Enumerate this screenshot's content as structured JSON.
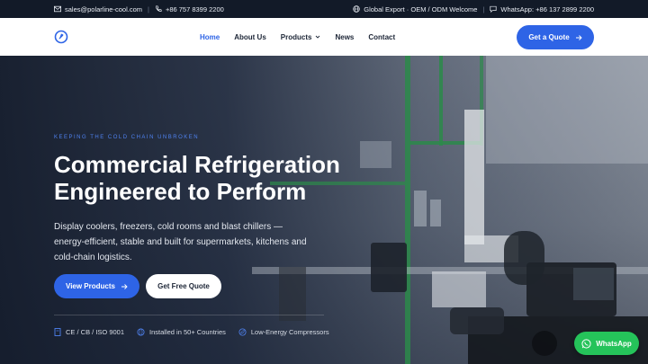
{
  "topbar": {
    "email": "sales@polarline-cool.com",
    "phone": "+86 757 8399 2200",
    "export_text": "Global Export · OEM / ODM Welcome",
    "whatsapp_text": "WhatsApp: +86 137 2899 2200"
  },
  "header": {
    "nav": [
      {
        "label": "Home"
      },
      {
        "label": "About Us"
      },
      {
        "label": "Products"
      },
      {
        "label": "News"
      },
      {
        "label": "Contact"
      }
    ],
    "quote_label": "Get a Quote"
  },
  "hero": {
    "eyebrow": "KEEPING THE COLD CHAIN UNBROKEN",
    "title_line1": "Commercial Refrigeration",
    "title_line2": "Engineered to Perform",
    "subtitle": "Display coolers, freezers, cold rooms and blast chillers — energy-efficient, stable and built for supermarkets, kitchens and cold-chain logistics.",
    "primary_label": "View Products",
    "secondary_label": "Get Free Quote",
    "features": [
      {
        "label": "CE / CB / ISO 9001",
        "icon": "certificate-icon"
      },
      {
        "label": "Installed in 50+ Countries",
        "icon": "globe-icon"
      },
      {
        "label": "Low-Energy Compressors",
        "icon": "leaf-icon"
      }
    ]
  },
  "whatsapp": {
    "label": "WhatsApp"
  },
  "colors": {
    "accent": "#2e64e6",
    "whatsapp": "#25c35a",
    "dark": "#121a28"
  }
}
